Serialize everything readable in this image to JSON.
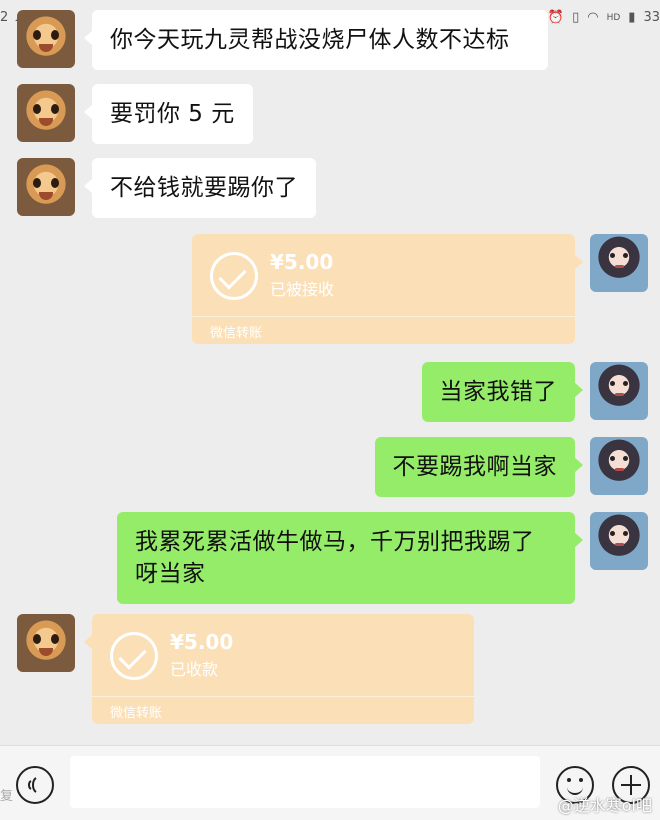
{
  "status_bar": {
    "time_fragment": "2",
    "battery_fragment": "33",
    "right_icons": [
      "alarm-icon",
      "vibrate-icon",
      "wifi-icon",
      "hd-icon",
      "signal-icon"
    ],
    "left_icons": [
      "cloud-icon",
      "location-icon"
    ]
  },
  "messages": [
    {
      "side": "in",
      "type": "text",
      "avatar": "cat-avatar",
      "text": "你今天玩九灵帮战没烧尸体人数不达标"
    },
    {
      "side": "in",
      "type": "text",
      "avatar": "cat-avatar",
      "text": "要罚你 5 元"
    },
    {
      "side": "in",
      "type": "text",
      "avatar": "cat-avatar",
      "text": "不给钱就要踢你了"
    },
    {
      "side": "out",
      "type": "transfer",
      "avatar": "girl-avatar",
      "amount": "¥5.00",
      "status": "已被接收",
      "footer": "微信转账"
    },
    {
      "side": "out",
      "type": "text",
      "avatar": "girl-avatar",
      "text": "当家我错了"
    },
    {
      "side": "out",
      "type": "text",
      "avatar": "girl-avatar",
      "text": "不要踢我啊当家"
    },
    {
      "side": "out",
      "type": "text",
      "avatar": "girl-avatar",
      "text": "我累死累活做牛做马，千万别把我踢了呀当家"
    },
    {
      "side": "in",
      "type": "transfer",
      "avatar": "cat-avatar",
      "amount": "¥5.00",
      "status": "已收款",
      "footer": "微信转账"
    }
  ],
  "input_bar": {
    "voice_icon": "voice-icon",
    "emoji_icon": "emoji-icon",
    "plus_icon": "plus-icon",
    "input_value": ""
  },
  "watermark": {
    "left_text": "复",
    "right_text": "@逆水寒ol吧"
  },
  "colors": {
    "background": "#ededed",
    "outgoing_bubble": "#95ec69",
    "incoming_bubble": "#ffffff",
    "transfer_card": "#fbe0b7"
  }
}
